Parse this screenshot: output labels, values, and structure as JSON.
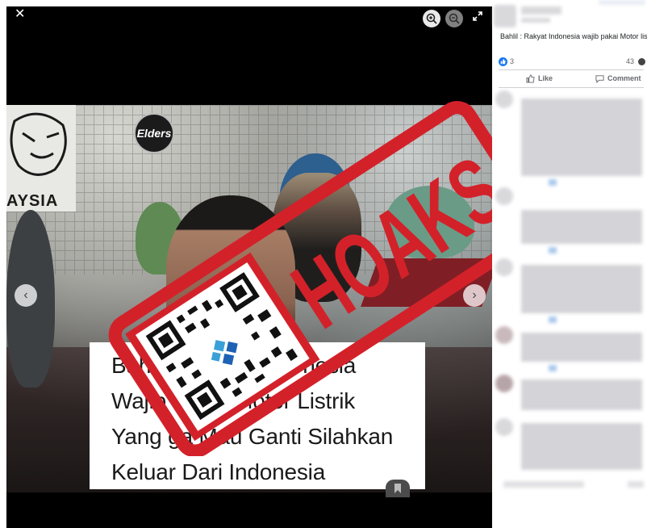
{
  "viewer": {
    "close_icon": "close-icon",
    "zoom_in_icon": "zoom-in-icon",
    "zoom_out_icon": "zoom-out-icon",
    "expand_icon": "expand-icon",
    "prev_icon": "chevron-left-icon",
    "next_icon": "chevron-right-icon"
  },
  "photo": {
    "poster_text": "AYSIA",
    "logo_text": "Elders",
    "caption_lines": [
      "Bahlil : Rakyat Indonesia",
      "Wajib Pakai Motor Listrik",
      "Yang ga Mau Ganti Silahkan",
      "Keluar Dari Indonesia"
    ]
  },
  "stamp": {
    "text": "HOAKS",
    "color": "#d3212a"
  },
  "post": {
    "text": "Bahlil : Rakyat Indonesia wajib pakai Motor listrik",
    "like_count": "3",
    "comment_count": "43",
    "like_label": "Like",
    "comment_label": "Comment"
  },
  "colors": {
    "facebook_blue": "#1877f2",
    "muted_text": "#65676b"
  }
}
